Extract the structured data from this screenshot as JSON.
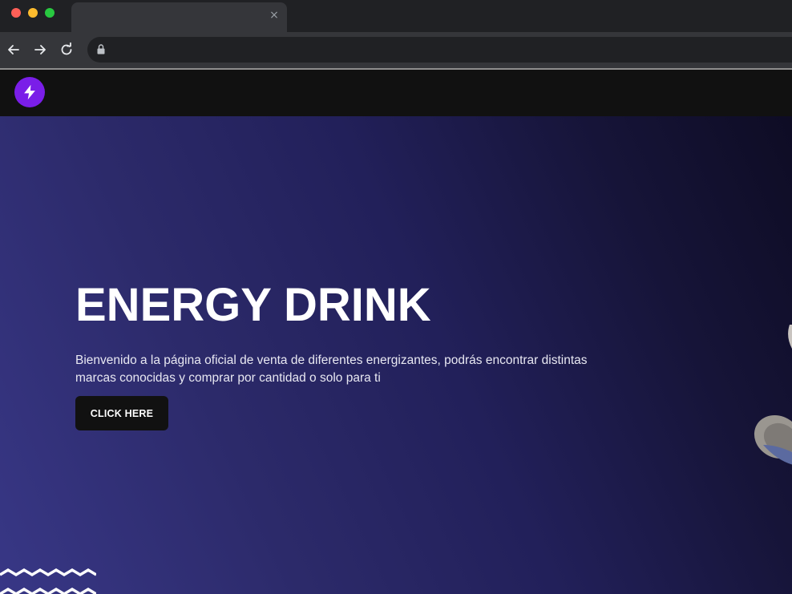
{
  "browser": {
    "tab": {
      "title": "",
      "close_label": "×"
    },
    "nav": {
      "back_icon": "arrow-left-icon",
      "forward_icon": "arrow-right-icon",
      "reload_icon": "reload-icon"
    },
    "address": {
      "url": "",
      "lock_icon": "lock-icon"
    }
  },
  "site": {
    "logo_icon": "lightning-bolt-icon",
    "logo_color": "#7a1ee8",
    "hero": {
      "title": "ENERGY DRINK",
      "description": "Bienvenido a la página oficial de venta de diferentes energizantes, podrás encontrar distintas marcas conocidas y comprar por cantidad o solo para ti",
      "cta_label": "CLICK HERE",
      "gradient_colors": [
        "#383786",
        "#22205a",
        "#0e0c24"
      ]
    }
  }
}
